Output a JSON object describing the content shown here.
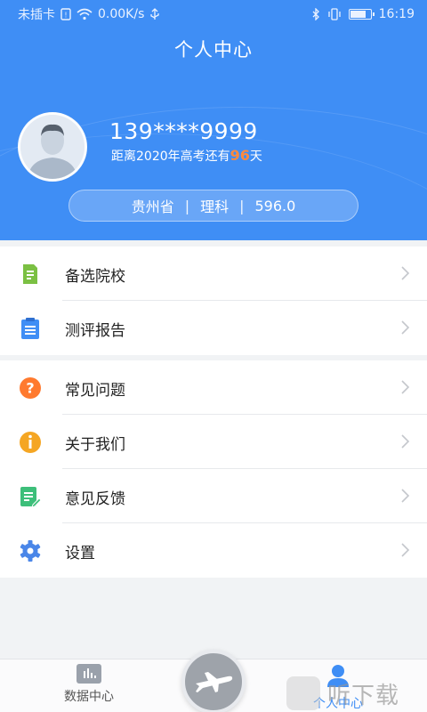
{
  "status_bar": {
    "carrier": "未插卡",
    "speed": "0.00K/s",
    "time": "16:19",
    "battery_level": 0.85
  },
  "header": {
    "title": "个人中心",
    "user": {
      "phone": "139****9999",
      "countdown_prefix": "距离2020年高考还有",
      "countdown_days": "96",
      "countdown_suffix": "天"
    },
    "info": {
      "province": "贵州省",
      "subject": "理科",
      "score": "596.0",
      "separator": "|"
    }
  },
  "menu_group1": [
    {
      "label": "备选院校",
      "icon": "school-list-icon",
      "color": "#7bc043"
    },
    {
      "label": "测评报告",
      "icon": "report-clipboard-icon",
      "color": "#3f8ef5"
    }
  ],
  "menu_group2": [
    {
      "label": "常见问题",
      "icon": "question-icon",
      "color": "#ff7a2f"
    },
    {
      "label": "关于我们",
      "icon": "info-icon",
      "color": "#f5a623"
    },
    {
      "label": "意见反馈",
      "icon": "feedback-icon",
      "color": "#3dbf7a"
    },
    {
      "label": "设置",
      "icon": "gear-icon",
      "color": "#4a86e8"
    }
  ],
  "bottom_nav": {
    "data_center": "数据中心",
    "me": "个人中心",
    "active": "me"
  },
  "watermark": {
    "text": "听下载"
  },
  "colors": {
    "primary": "#3f8ef5",
    "accent_orange": "#ff8a3d"
  }
}
